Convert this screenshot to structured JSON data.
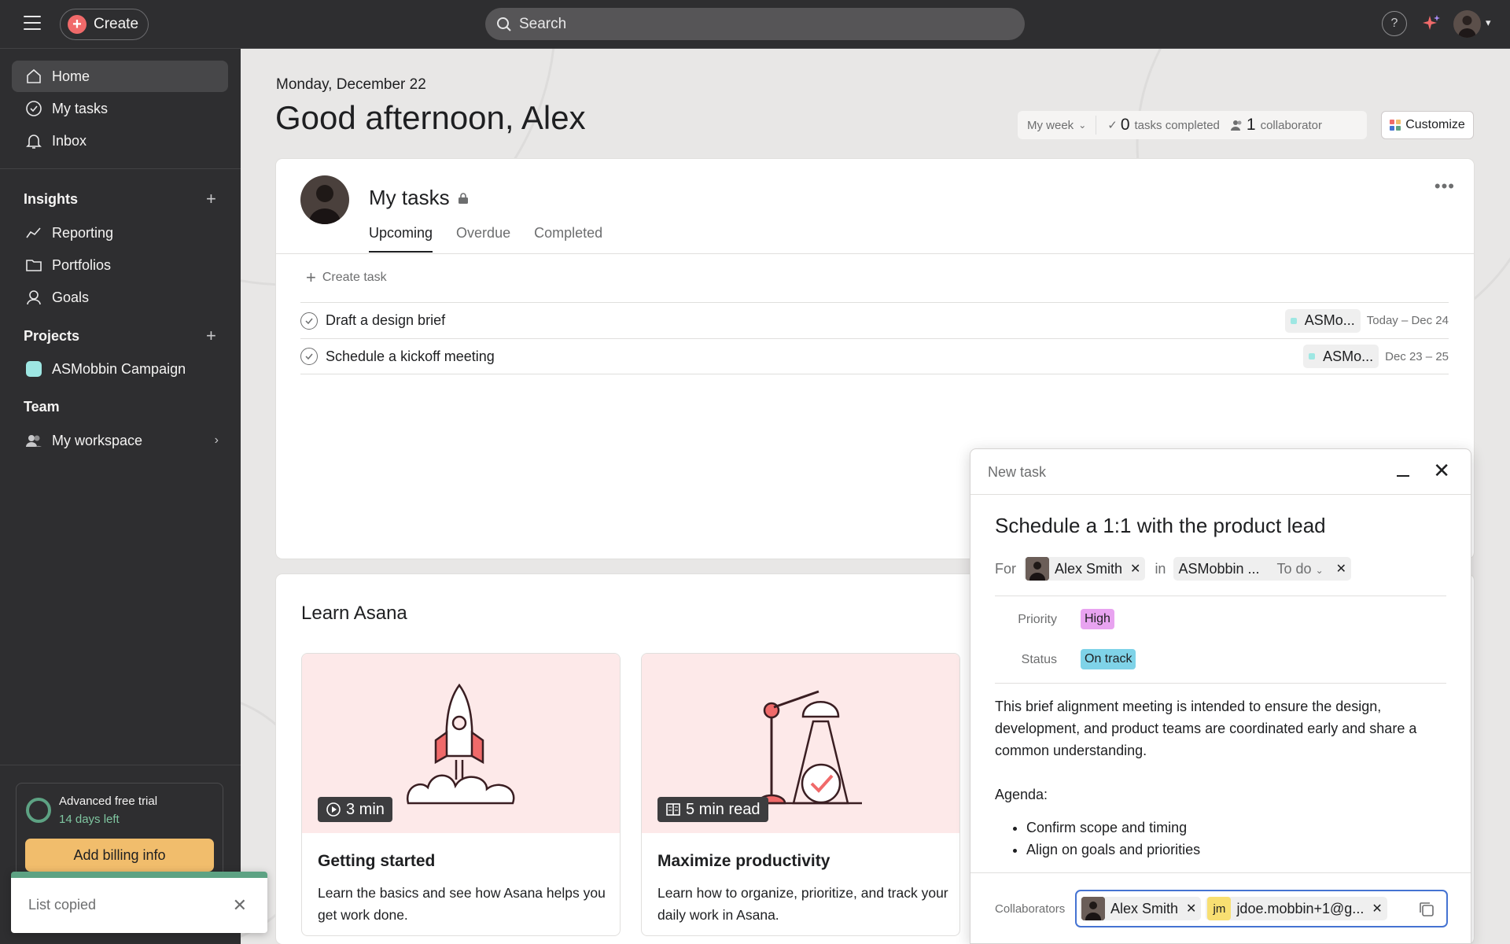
{
  "topbar": {
    "create_label": "Create",
    "search_placeholder": "Search",
    "help_label": "?"
  },
  "sidebar": {
    "nav": [
      {
        "label": "Home",
        "icon": "home-icon"
      },
      {
        "label": "My tasks",
        "icon": "check-circle-icon"
      },
      {
        "label": "Inbox",
        "icon": "bell-icon"
      }
    ],
    "insights_heading": "Insights",
    "insights": [
      {
        "label": "Reporting",
        "icon": "reporting-icon"
      },
      {
        "label": "Portfolios",
        "icon": "folder-icon"
      },
      {
        "label": "Goals",
        "icon": "goals-icon"
      }
    ],
    "projects_heading": "Projects",
    "projects": [
      {
        "label": "ASMobbin Campaign",
        "color": "#9ee7e3"
      }
    ],
    "team_heading": "Team",
    "team": [
      {
        "label": "My workspace",
        "icon": "people-icon"
      }
    ],
    "trial": {
      "title": "Advanced free trial",
      "days_left": "14 days left",
      "billing_button": "Add billing info"
    }
  },
  "toast": {
    "text": "List copied"
  },
  "home": {
    "date": "Monday, December 22",
    "greeting": "Good afternoon, Alex",
    "period": "My week",
    "tasks_completed_count": "0",
    "tasks_completed_label": "tasks completed",
    "collaborator_count": "1",
    "collaborator_label": "collaborator",
    "customize_label": "Customize"
  },
  "my_tasks": {
    "title": "My tasks",
    "tabs": [
      "Upcoming",
      "Overdue",
      "Completed"
    ],
    "active_tab": "Upcoming",
    "create_task_label": "Create task",
    "tasks": [
      {
        "name": "Draft a design brief",
        "project": "ASMo...",
        "due": "Today – Dec 24"
      },
      {
        "name": "Schedule a kickoff meeting",
        "project": "ASMo...",
        "due": "Dec 23 – 25"
      }
    ]
  },
  "learn": {
    "title": "Learn Asana",
    "cards": [
      {
        "badge": "3 min",
        "title": "Getting started",
        "desc": "Learn the basics and see how Asana helps you get work done."
      },
      {
        "badge": "5 min read",
        "title": "Maximize productivity",
        "desc": "Learn how to organize, prioritize, and track your daily work in Asana."
      }
    ]
  },
  "new_task": {
    "header": "New task",
    "title": "Schedule a 1:1 with the product lead",
    "for_label": "For",
    "assignee": "Alex Smith",
    "in_label": "in",
    "project": "ASMobbin ...",
    "section": "To do",
    "priority_label": "Priority",
    "priority_value": "High",
    "priority_color": "#e8a3f0",
    "status_label": "Status",
    "status_value": "On track",
    "status_color": "#7fd3e8",
    "description": "This brief alignment meeting is intended to ensure the design, development, and product teams are coordinated early and share a common understanding.",
    "agenda_label": "Agenda:",
    "agenda_items": [
      "Confirm scope and timing",
      "Align on goals and priorities"
    ],
    "collaborators_label": "Collaborators",
    "collaborators": [
      {
        "name": "Alex Smith"
      },
      {
        "initials": "jm",
        "name": "jdoe.mobbin+1@g..."
      }
    ]
  }
}
